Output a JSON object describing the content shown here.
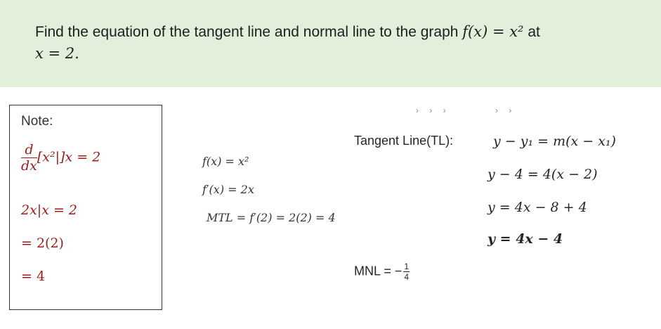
{
  "question": {
    "text_pre": "Find the equation of the tangent line and normal line to the graph ",
    "fx": "f(x) = x²",
    "text_at": " at",
    "point": "x = 2."
  },
  "note": {
    "title": "Note:",
    "d_num": "d",
    "d_den": "dx",
    "expr": "[x²|]x = 2",
    "line2": "2x|x = 2",
    "line3": "= 2(2)",
    "line4": "= 4"
  },
  "middle": {
    "line1": "f(x) = x²",
    "line2": "f′(x) = 2x",
    "line3": "MTL = f′(2) = 2(2) = 4"
  },
  "tangent": {
    "label": "Tangent Line(TL):",
    "eq1": "y − y₁ = m(x − x₁)",
    "eq2": "y − 4 = 4(x − 2)",
    "eq3": "y = 4x − 8 + 4",
    "eq4": "y = 4x − 4"
  },
  "normal": {
    "label": "MNL = −",
    "num": "1",
    "den": "4"
  },
  "colors": {
    "banner_bg": "#e2efdb",
    "note_red": "#9c1c1c"
  }
}
